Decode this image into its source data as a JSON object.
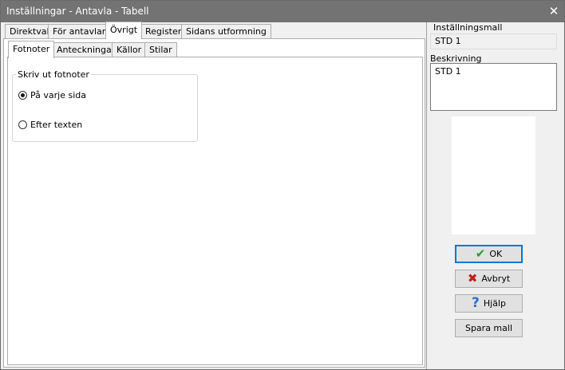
{
  "window": {
    "title": "Inställningar - Antavla - Tabell",
    "close": "✕"
  },
  "tabs": [
    {
      "label": "Direktval"
    },
    {
      "label": "För antavlan"
    },
    {
      "label": "Övrigt"
    },
    {
      "label": "Register"
    },
    {
      "label": "Sidans utformning"
    }
  ],
  "subtabs": [
    {
      "label": "Fotnoter"
    },
    {
      "label": "Anteckningar"
    },
    {
      "label": "Källor"
    },
    {
      "label": "Stilar"
    }
  ],
  "fotnoter": {
    "group_label": "Skriv ut fotnoter",
    "options": [
      {
        "label": "På varje sida",
        "checked": true
      },
      {
        "label": "Efter texten",
        "checked": false
      }
    ]
  },
  "sidebar": {
    "mall_label": "Inställningsmall",
    "mall_value": "STD 1",
    "desc_label": "Beskrivning",
    "desc_value": "STD 1"
  },
  "buttons": {
    "ok": "OK",
    "cancel": "Avbryt",
    "help": "Hjälp",
    "save": "Spara mall"
  },
  "icons": {
    "ok": "check-icon",
    "cancel": "x-icon",
    "help": "question-icon",
    "ok_color": "#2a9a2a",
    "cancel_color": "#c0201a",
    "help_color": "#2a70c8"
  }
}
